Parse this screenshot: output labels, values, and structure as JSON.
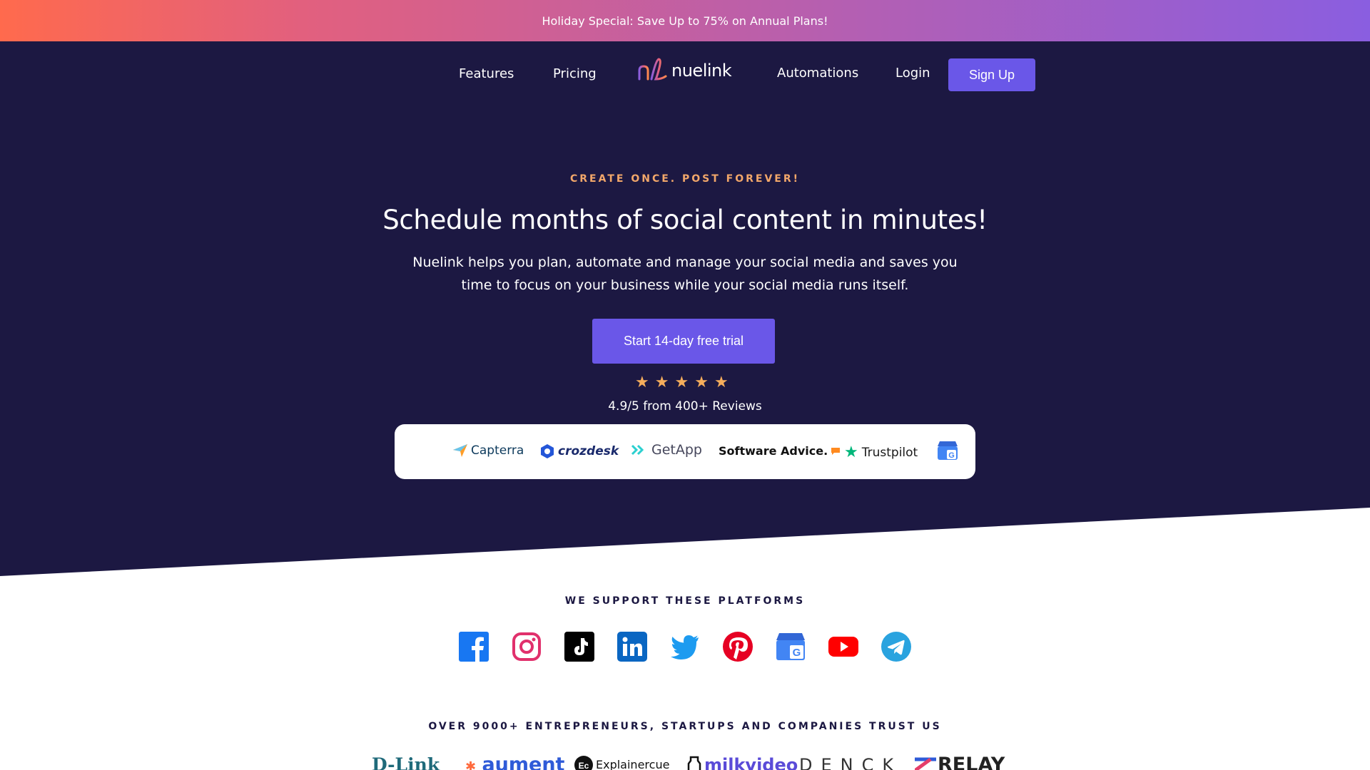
{
  "promo": {
    "text": "Holiday Special: Save Up to 75% on Annual Plans!"
  },
  "nav": {
    "features": "Features",
    "pricing": "Pricing",
    "logo_text": "nuelink",
    "automations": "Automations",
    "login": "Login",
    "signup": "Sign Up"
  },
  "hero": {
    "eyebrow": "CREATE ONCE. POST FOREVER!",
    "headline": "Schedule months of social content in minutes!",
    "subtext_line1": "Nuelink helps you plan, automate and manage your social media and saves you",
    "subtext_line2": "time to focus on your business while your social media runs itself.",
    "cta": "Start 14-day free trial",
    "rating": {
      "stars": 5,
      "text": "4.9/5 from 400+ Reviews"
    }
  },
  "review_sites": [
    "Capterra",
    "crozdesk",
    "GetApp",
    "Software Advice.",
    "Trustpilot"
  ],
  "platforms": {
    "title": "WE SUPPORT THESE PLATFORMS",
    "icons": [
      "facebook-icon",
      "instagram-icon",
      "tiktok-icon",
      "linkedin-icon",
      "twitter-icon",
      "pinterest-icon",
      "google-business-icon",
      "youtube-icon",
      "telegram-icon"
    ]
  },
  "trust": {
    "title": "OVER 9000+ ENTREPRENEURS, STARTUPS AND COMPANIES TRUST US",
    "brands": [
      "D-Link",
      "aument",
      "Explainercue",
      "milkvideo",
      "DENCK",
      "RELAY"
    ]
  },
  "colors": {
    "navy": "#1c1842",
    "accent": "#6a57e8",
    "star": "#f5ad5c",
    "eyebrow": "#f2a76a"
  }
}
